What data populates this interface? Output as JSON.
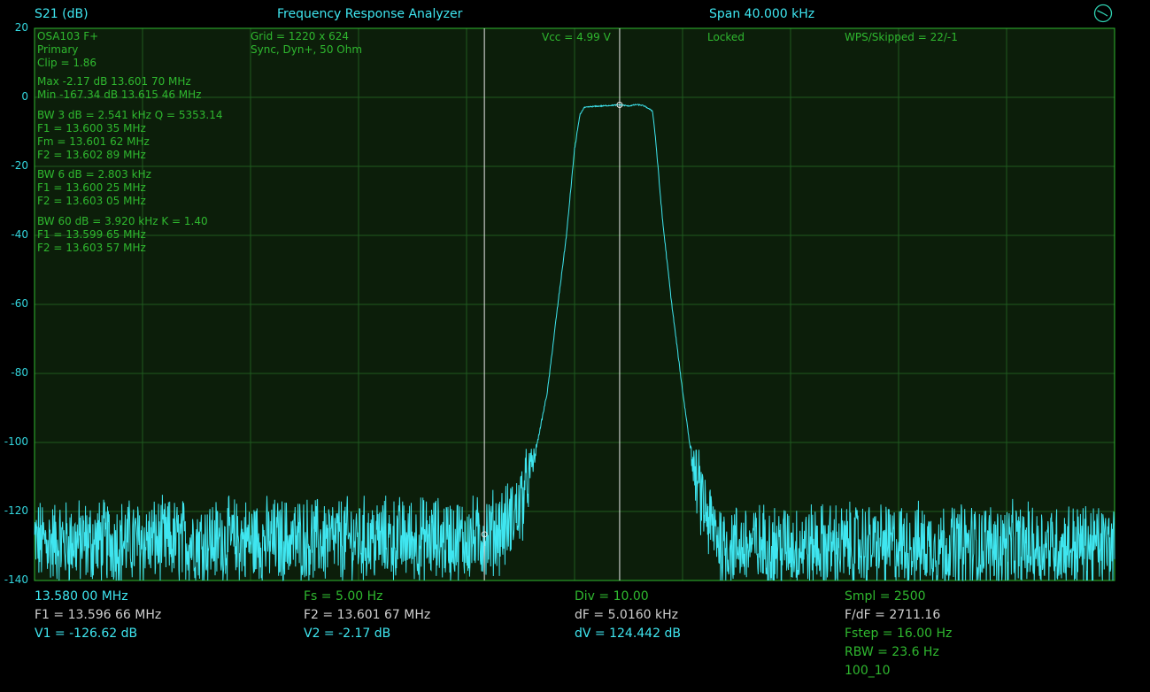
{
  "header": {
    "trace_label": "S21 (dB)",
    "app_title": "Frequency Response Analyzer",
    "span": "Span 40.000 kHz",
    "settings_icon": "gauge-icon"
  },
  "overlay": {
    "left": [
      [
        "OSA103 F+",
        "Primary",
        "Clip = 1.86"
      ],
      [
        "Max -2.17 dB  13.601 70 MHz",
        "Min -167.34 dB  13.615 46 MHz"
      ],
      [
        "BW 3 dB = 2.541 kHz  Q = 5353.14",
        "F1 = 13.600 35 MHz",
        "Fm = 13.601 62 MHz",
        "F2 = 13.602 89 MHz"
      ],
      [
        "BW 6 dB = 2.803 kHz",
        "F1 = 13.600 25 MHz",
        "F2 = 13.603 05 MHz"
      ],
      [
        "BW 60 dB = 3.920 kHz  K = 1.40",
        "F1 = 13.599 65 MHz",
        "F2 = 13.603 57 MHz"
      ]
    ],
    "grid": [
      "Grid = 1220 x 624",
      "Sync,  Dyn+, 50 Ohm"
    ],
    "vcc": "Vcc = 4.99 V",
    "lock": "Locked",
    "wps": "WPS/Skipped  = 22/-1"
  },
  "footer": {
    "col1": [
      "13.580 00 MHz",
      "F1 = 13.596 66 MHz",
      "V1 = -126.62 dB"
    ],
    "col2": [
      "Fs = 5.00 Hz",
      "F2 = 13.601 67 MHz",
      "V2 = -2.17 dB"
    ],
    "col3": [
      "Div = 10.00",
      "dF = 5.0160 kHz",
      "dV = 124.442 dB"
    ],
    "col4": [
      "Smpl = 2500",
      "F/dF = 2711.16",
      "Fstep = 16.00 Hz",
      "RBW = 23.6 Hz",
      "100_10"
    ]
  },
  "colors": {
    "background": "#000000",
    "plot_bg": "#0c1e0a",
    "grid": "#1f5a1f",
    "frame": "#2fb82f",
    "trace": "#3fe6f0",
    "marker": "#e8e8e8"
  },
  "chart_data": {
    "type": "line",
    "title": "",
    "xlabel": "",
    "ylabel": "S21 (dB)",
    "x_unit": "MHz",
    "xlim": [
      13.58,
      13.62
    ],
    "ylim": [
      -140,
      20
    ],
    "y_ticks": [
      20,
      0,
      -20,
      -40,
      -60,
      -80,
      -100,
      -120,
      -140
    ],
    "x_divisions": 10,
    "grid": true,
    "markers": [
      {
        "name": "F1",
        "x": 13.59666,
        "y": -126.62
      },
      {
        "name": "F2",
        "x": 13.60167,
        "y": -2.17
      }
    ],
    "series": [
      {
        "noise_floor_db": -129,
        "x": [
          13.58,
          13.5965,
          13.5975,
          13.598,
          13.5985,
          13.599,
          13.59935,
          13.5997,
          13.6,
          13.6002,
          13.60035,
          13.6006,
          13.601,
          13.6014,
          13.60165,
          13.6017,
          13.602,
          13.6023,
          13.6025,
          13.60265,
          13.60289,
          13.603,
          13.60325,
          13.6036,
          13.604,
          13.6044,
          13.6049,
          13.6055,
          13.62
        ],
        "y": [
          -129,
          -128,
          -124,
          -118,
          -105,
          -85,
          -62,
          -40,
          -15,
          -5,
          -3,
          -2.7,
          -2.5,
          -2.3,
          -2.2,
          -2.17,
          -2.5,
          -2.1,
          -2.3,
          -2.8,
          -4,
          -12,
          -35,
          -60,
          -85,
          -108,
          -122,
          -130,
          -130
        ]
      }
    ]
  }
}
